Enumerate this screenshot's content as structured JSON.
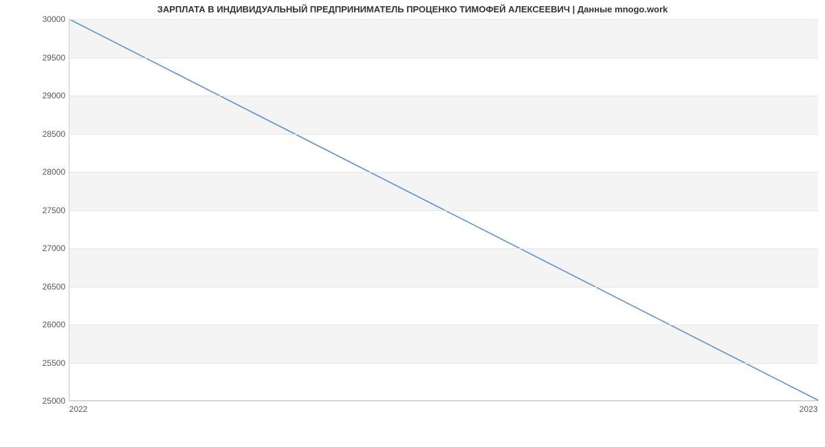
{
  "chart_data": {
    "type": "line",
    "title": "ЗАРПЛАТА В ИНДИВИДУАЛЬНЫЙ ПРЕДПРИНИМАТЕЛЬ ПРОЦЕНКО ТИМОФЕЙ АЛЕКСЕЕВИЧ | Данные mnogo.work",
    "xlabel": "",
    "ylabel": "",
    "x": [
      2022,
      2023
    ],
    "values": [
      30000,
      25000
    ],
    "ylim": [
      25000,
      30000
    ],
    "xlim": [
      2022,
      2023
    ],
    "y_ticks": [
      25000,
      25500,
      26000,
      26500,
      27000,
      27500,
      28000,
      28500,
      29000,
      29500,
      30000
    ],
    "x_ticks": [
      2022,
      2023
    ],
    "line_color": "#5b8fd6"
  }
}
